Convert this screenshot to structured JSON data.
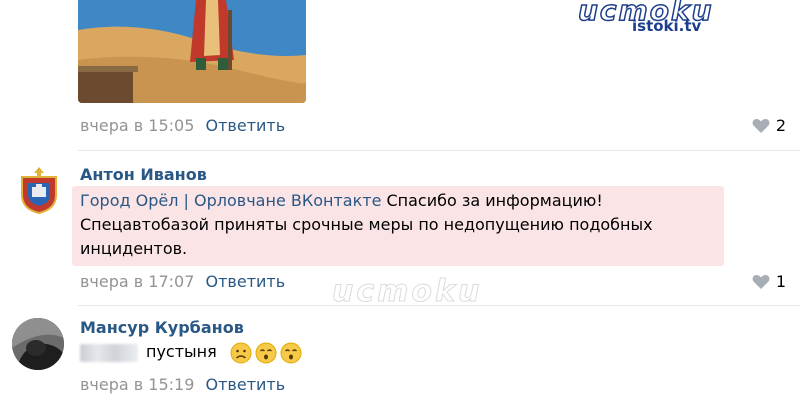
{
  "comments": [
    {
      "date": "вчера в 15:05",
      "reply_label": "Ответить",
      "likes": "2"
    },
    {
      "author": "Антон Иванов",
      "mention": "Город Орёл | Орловчане ВКонтакте",
      "text": " Спасибо за информацию! Спецавтобазой приняты срочные меры по недопущению подобных инцидентов.",
      "date": "вчера в 17:07",
      "reply_label": "Ответить",
      "likes": "1"
    },
    {
      "author": "Мансур Курбанов",
      "text": "пустыня",
      "emojis": [
        "frowning-face-emoji",
        "hushed-face-emoji",
        "hushed-face-emoji"
      ],
      "date": "вчера в 15:19",
      "reply_label": "Ответить"
    }
  ],
  "watermark": {
    "logo": "UCMOKU",
    "site": "istoki.tv"
  },
  "colors": {
    "link": "#2a5885",
    "date": "#939393",
    "highlight": "#fbe4e6",
    "brand": "#1d3e8c"
  }
}
